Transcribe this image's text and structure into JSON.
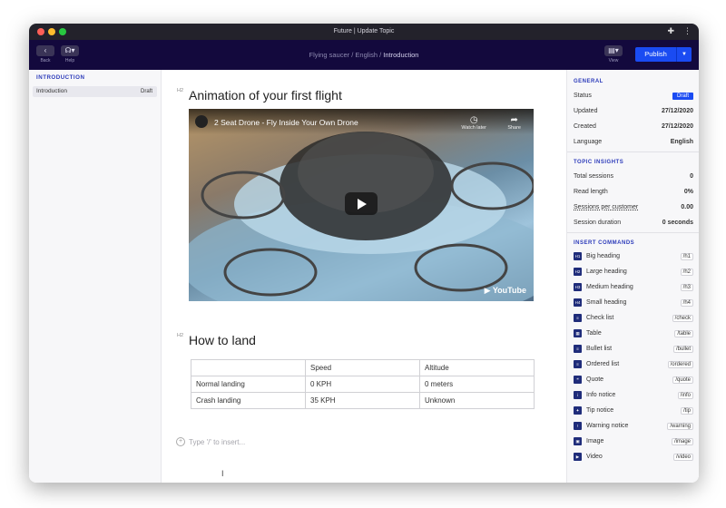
{
  "window": {
    "title": "Future | Update Topic"
  },
  "toolbar": {
    "back_label": "Back",
    "help_label": "Help",
    "breadcrumb": [
      "Flying saucer",
      "English",
      "Introduction"
    ],
    "view_label": "View",
    "publish_label": "Publish"
  },
  "left_panel": {
    "header": "INTRODUCTION",
    "items": [
      {
        "label": "Introduction",
        "badge": "Draft"
      }
    ]
  },
  "content": {
    "section1": {
      "tag": "H2",
      "heading": "Animation of your first flight"
    },
    "video": {
      "title": "2 Seat Drone - Fly Inside Your Own Drone",
      "watch_later": "Watch later",
      "share": "Share",
      "brand": "YouTube"
    },
    "section2": {
      "tag": "H2",
      "heading": "How to land"
    },
    "table": {
      "rows": [
        [
          "",
          "Speed",
          "Altitude"
        ],
        [
          "Normal landing",
          "0 KPH",
          "0 meters"
        ],
        [
          "Crash landing",
          "35 KPH",
          "Unknown"
        ]
      ]
    },
    "insert_placeholder": "Type '/' to insert..."
  },
  "right_panel": {
    "general": {
      "header": "GENERAL",
      "rows": [
        {
          "label": "Status",
          "value": "Draft"
        },
        {
          "label": "Updated",
          "value": "27/12/2020"
        },
        {
          "label": "Created",
          "value": "27/12/2020"
        },
        {
          "label": "Language",
          "value": "English"
        }
      ]
    },
    "insights": {
      "header": "TOPIC INSIGHTS",
      "rows": [
        {
          "label": "Total sessions",
          "value": "0"
        },
        {
          "label": "Read length",
          "value": "0%"
        },
        {
          "label": "Sessions per customer",
          "value": "0.00"
        },
        {
          "label": "Session duration",
          "value": "0 seconds"
        }
      ]
    },
    "commands": {
      "header": "INSERT COMMANDS",
      "items": [
        {
          "icon": "H1",
          "label": "Big heading",
          "shortcut": "/h1"
        },
        {
          "icon": "H2",
          "label": "Large heading",
          "shortcut": "/h2"
        },
        {
          "icon": "H3",
          "label": "Medium heading",
          "shortcut": "/h3"
        },
        {
          "icon": "H4",
          "label": "Small heading",
          "shortcut": "/h4"
        },
        {
          "icon": "≡",
          "label": "Check list",
          "shortcut": "/check"
        },
        {
          "icon": "▦",
          "label": "Table",
          "shortcut": "/table"
        },
        {
          "icon": "≡",
          "label": "Bullet list",
          "shortcut": "/bullet"
        },
        {
          "icon": "≡",
          "label": "Ordered list",
          "shortcut": "/ordered"
        },
        {
          "icon": "❝",
          "label": "Quote",
          "shortcut": "/quote"
        },
        {
          "icon": "i",
          "label": "Info notice",
          "shortcut": "/info"
        },
        {
          "icon": "✦",
          "label": "Tip notice",
          "shortcut": "/tip"
        },
        {
          "icon": "!",
          "label": "Warning notice",
          "shortcut": "/warning"
        },
        {
          "icon": "▣",
          "label": "Image",
          "shortcut": "/image"
        },
        {
          "icon": "▶",
          "label": "Video",
          "shortcut": "/video"
        }
      ]
    }
  }
}
